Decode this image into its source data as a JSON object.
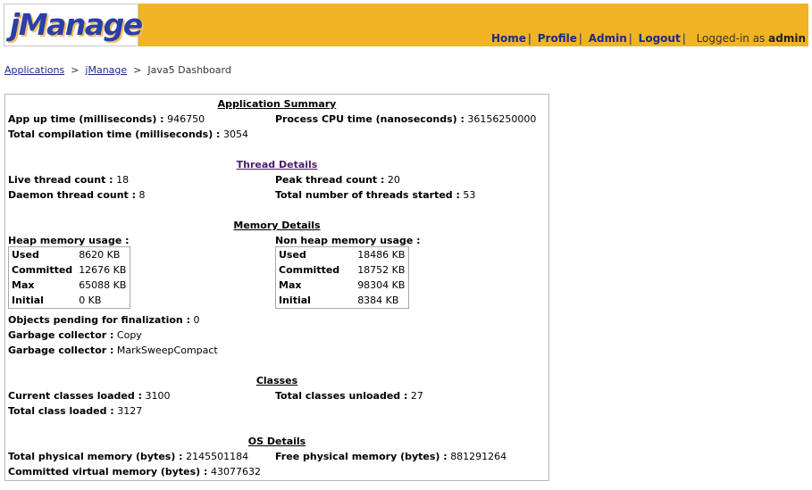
{
  "header": {
    "logo": "jManage",
    "nav": {
      "home": "Home",
      "profile": "Profile",
      "admin": "Admin",
      "logout": "Logout",
      "sep": "|"
    },
    "logged_in_prefix": "Logged-in as",
    "user": "admin"
  },
  "breadcrumb": {
    "applications": "Applications",
    "app": "jManage",
    "current": "Java5 Dashboard",
    "arrow": ">"
  },
  "summary": {
    "title": "Application Summary",
    "uptime_label": "App up time (milliseconds) :",
    "uptime": "946750",
    "cpu_label": "Process CPU time (nanoseconds) :",
    "cpu": "36156250000",
    "compile_label": "Total compilation time (milliseconds) :",
    "compile": "3054"
  },
  "threads": {
    "title": "Thread Details",
    "live_label": "Live thread count :",
    "live": "18",
    "peak_label": "Peak thread count :",
    "peak": "20",
    "daemon_label": "Daemon thread count :",
    "daemon": "8",
    "started_label": "Total number of threads started :",
    "started": "53"
  },
  "memory": {
    "title": "Memory Details",
    "heap_label": "Heap memory usage :",
    "nonheap_label": "Non heap memory usage :",
    "heap": [
      {
        "k": "Used",
        "v": "8620 KB"
      },
      {
        "k": "Committed",
        "v": "12676 KB"
      },
      {
        "k": "Max",
        "v": "65088 KB"
      },
      {
        "k": "Initial",
        "v": "0 KB"
      }
    ],
    "nonheap": [
      {
        "k": "Used",
        "v": "18486 KB"
      },
      {
        "k": "Committed",
        "v": "18752 KB"
      },
      {
        "k": "Max",
        "v": "98304 KB"
      },
      {
        "k": "Initial",
        "v": "8384 KB"
      }
    ],
    "pending_label": "Objects pending for finalization :",
    "pending": "0",
    "gc_label": "Garbage collector :",
    "gc1": "Copy",
    "gc2": "MarkSweepCompact"
  },
  "classes": {
    "title": "Classes",
    "current_label": "Current classes loaded :",
    "current": "3100",
    "unloaded_label": "Total classes unloaded :",
    "unloaded": "27",
    "total_label": "Total class loaded :",
    "total": "3127"
  },
  "os": {
    "title": "OS Details",
    "phys_label": "Total physical memory (bytes) :",
    "phys": "2145501184",
    "free_label": "Free physical memory (bytes) :",
    "free": "881291264",
    "virt_label": "Committed virtual memory (bytes) :",
    "virt": "43077632"
  }
}
